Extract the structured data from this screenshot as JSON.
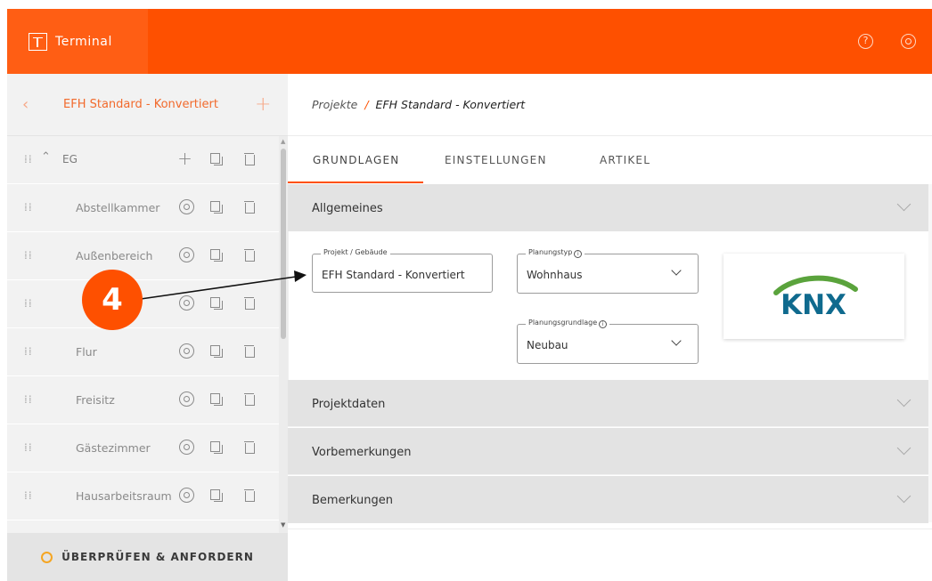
{
  "header": {
    "app_name": "Terminal",
    "help_icon": "question-circle-icon",
    "settings_icon": "gear-icon",
    "brand_color": "#fe5000"
  },
  "sidebar": {
    "project_title": "EFH Standard - Konvertiert",
    "level": {
      "name": "EG",
      "expanded": true
    },
    "rooms": [
      {
        "name": "Abstellkammer"
      },
      {
        "name": "Außenbereich"
      },
      {
        "name": ""
      },
      {
        "name": "Flur"
      },
      {
        "name": "Freisitz"
      },
      {
        "name": "Gästezimmer"
      },
      {
        "name": "Hausarbeitsraum"
      }
    ],
    "review_button": "ÜBERPRÜFEN & ANFORDERN"
  },
  "breadcrumb": {
    "root": "Projekte",
    "separator": "/",
    "current": "EFH Standard - Konvertiert"
  },
  "tabs": [
    {
      "label": "GRUNDLAGEN",
      "active": true
    },
    {
      "label": "EINSTELLUNGEN",
      "active": false
    },
    {
      "label": "ARTIKEL",
      "active": false
    }
  ],
  "sections": {
    "allgemeines": {
      "title": "Allgemeines",
      "expanded": true,
      "fields": {
        "projekt": {
          "label": "Projekt / Gebäude",
          "value": "EFH Standard - Konvertiert"
        },
        "planungstyp": {
          "label": "Planungstyp",
          "value": "Wohnhaus"
        },
        "planungsgrundlage": {
          "label": "Planungsgrundlage",
          "value": "Neubau"
        }
      },
      "logo_text": "KNX"
    },
    "projektdaten": {
      "title": "Projektdaten"
    },
    "vorbemerkungen": {
      "title": "Vorbemerkungen"
    },
    "bemerkungen": {
      "title": "Bemerkungen"
    }
  },
  "annotation": {
    "number": "4"
  }
}
